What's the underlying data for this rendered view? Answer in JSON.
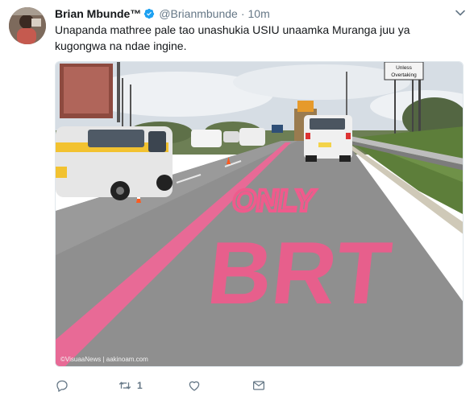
{
  "tweet": {
    "display_name": "Brian Mbunde™",
    "handle": "@Brianmbunde",
    "separator": "·",
    "time": "10m",
    "text": "Unapanda mathree pale tao unashukia USIU unaamka Muranga juu ya kugongwa na ndae ingine.",
    "photo": {
      "road_text_top": "ONLY",
      "road_text_bottom": "BRT",
      "sign_text_line1": "Unless",
      "sign_text_line2": "Overtaking",
      "watermark": "©VisuaaNews | aakinoam.com"
    },
    "actions": {
      "reply_count": "",
      "retweet_count": "1",
      "like_count": ""
    }
  },
  "colors": {
    "verified": "#1da1f2",
    "text": "#14171a",
    "muted": "#657786",
    "road_paint": "#ef5b8c"
  }
}
